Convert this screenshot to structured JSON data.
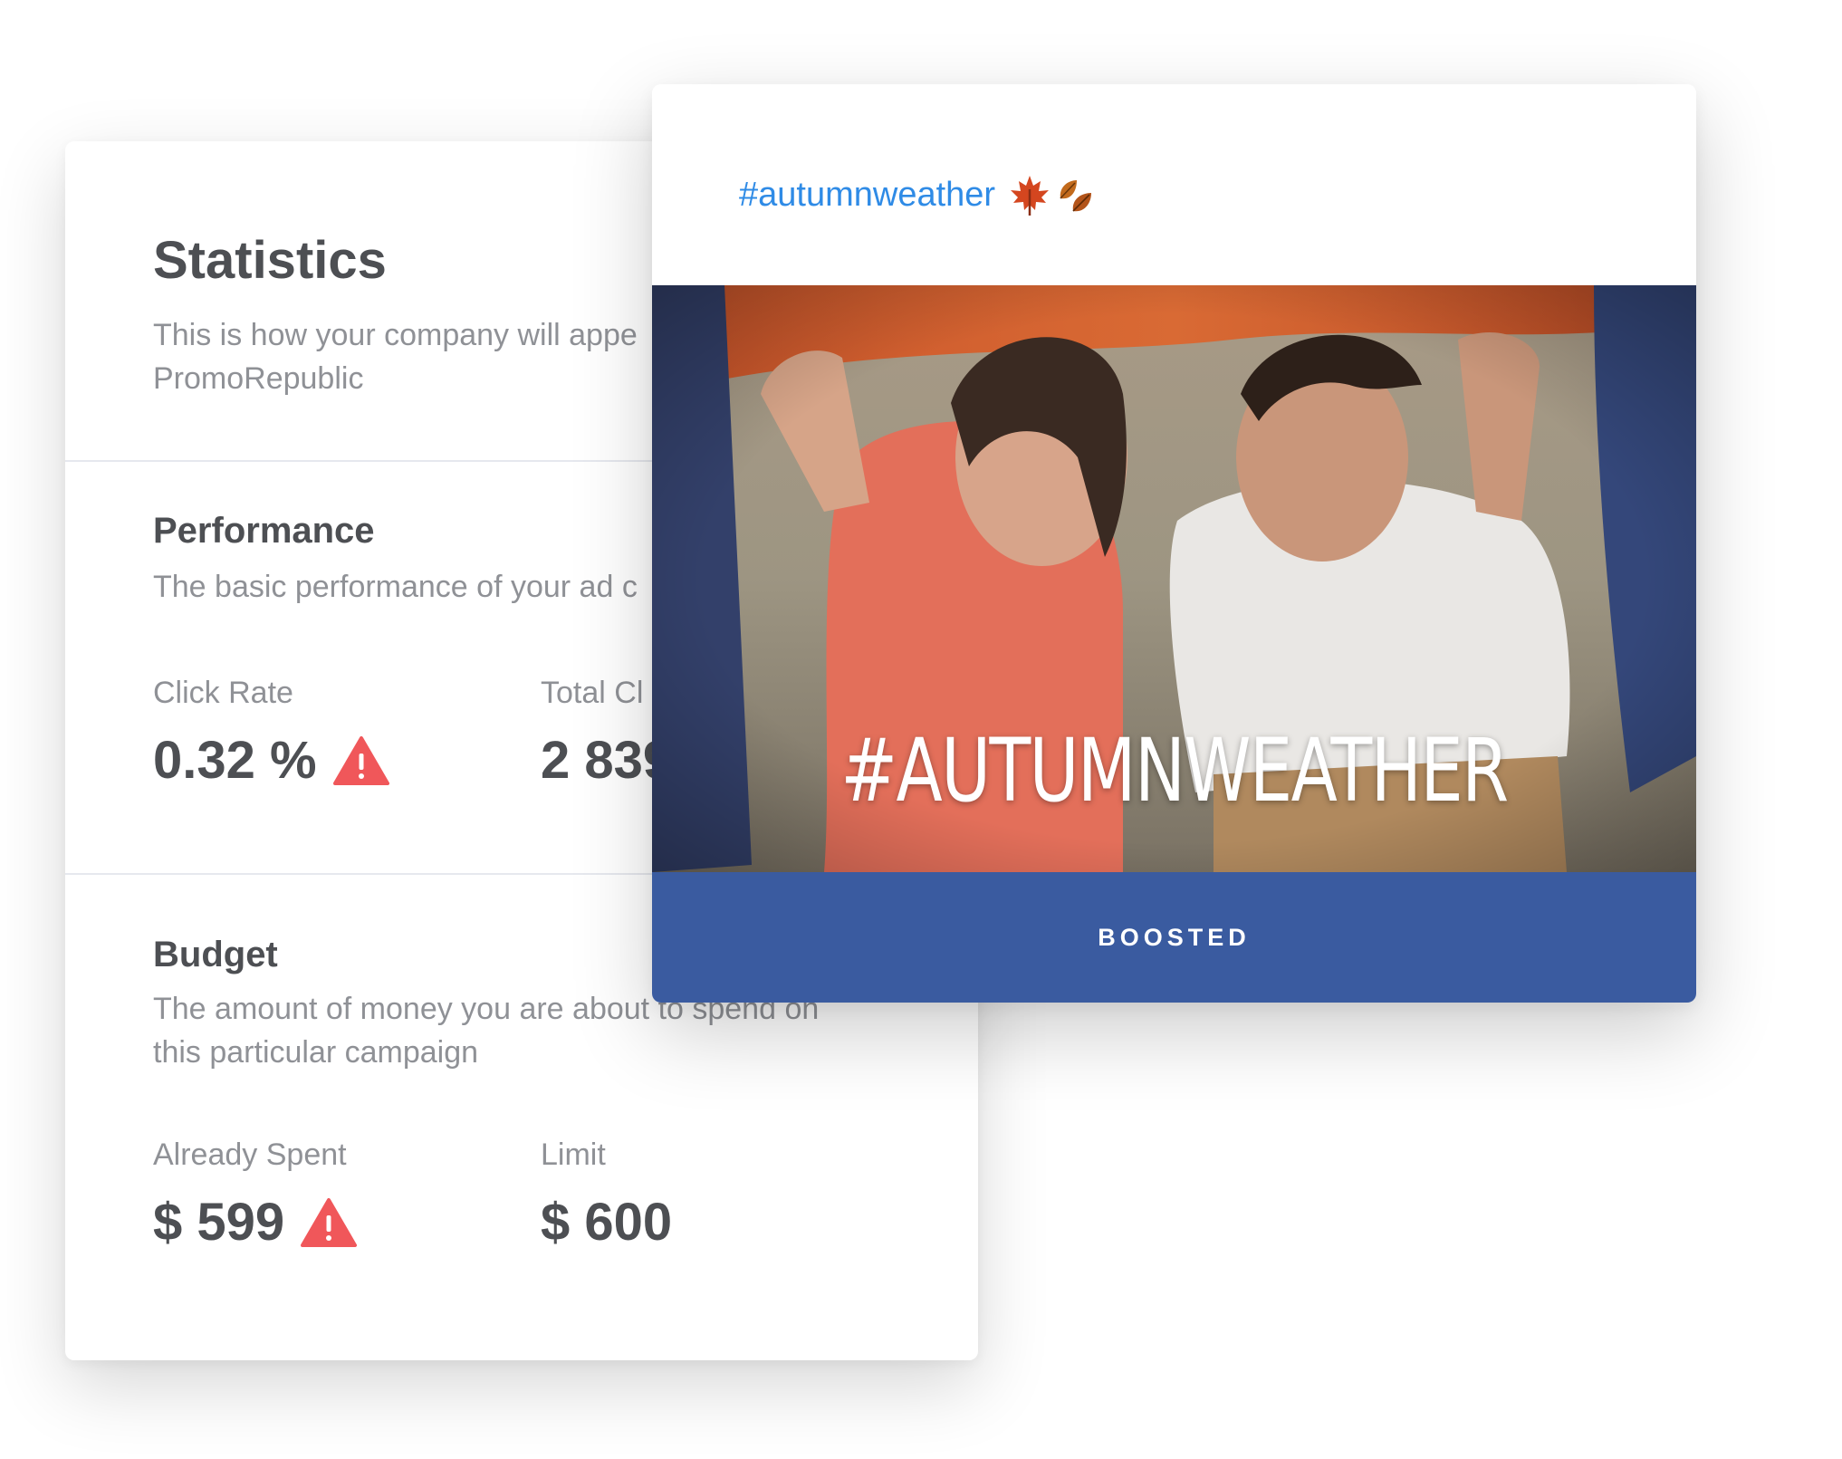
{
  "stats": {
    "title": "Statistics",
    "subtitle": "This is how your company will appe",
    "subtitle_line2": "PromoRepublic",
    "performance": {
      "title": "Performance",
      "subtitle": "The basic performance of your ad c",
      "click_rate_label": "Click Rate",
      "click_rate_value": "0.32 %",
      "total_label": "Total Cl",
      "total_value": "2 839"
    },
    "budget": {
      "title": "Budget",
      "subtitle": "The amount of money you are about to spend on",
      "subtitle_line2": "this particular campaign",
      "spent_label": "Already Spent",
      "spent_value": "$ 599",
      "limit_label": "Limit",
      "limit_value": "$ 600"
    }
  },
  "post": {
    "hashtag": "#autumnweather",
    "image_overlay": "#AUTUMNWEATHER",
    "status_button": "BOOSTED"
  },
  "icons": {
    "warning": "warning-triangle-icon",
    "leaves": "autumn-leaves-icon"
  },
  "colors": {
    "warning": "#f0575a",
    "link": "#2f8be6",
    "boost_bar": "#3a5ba0",
    "heading": "#4d4f53",
    "muted": "#8f9196"
  }
}
